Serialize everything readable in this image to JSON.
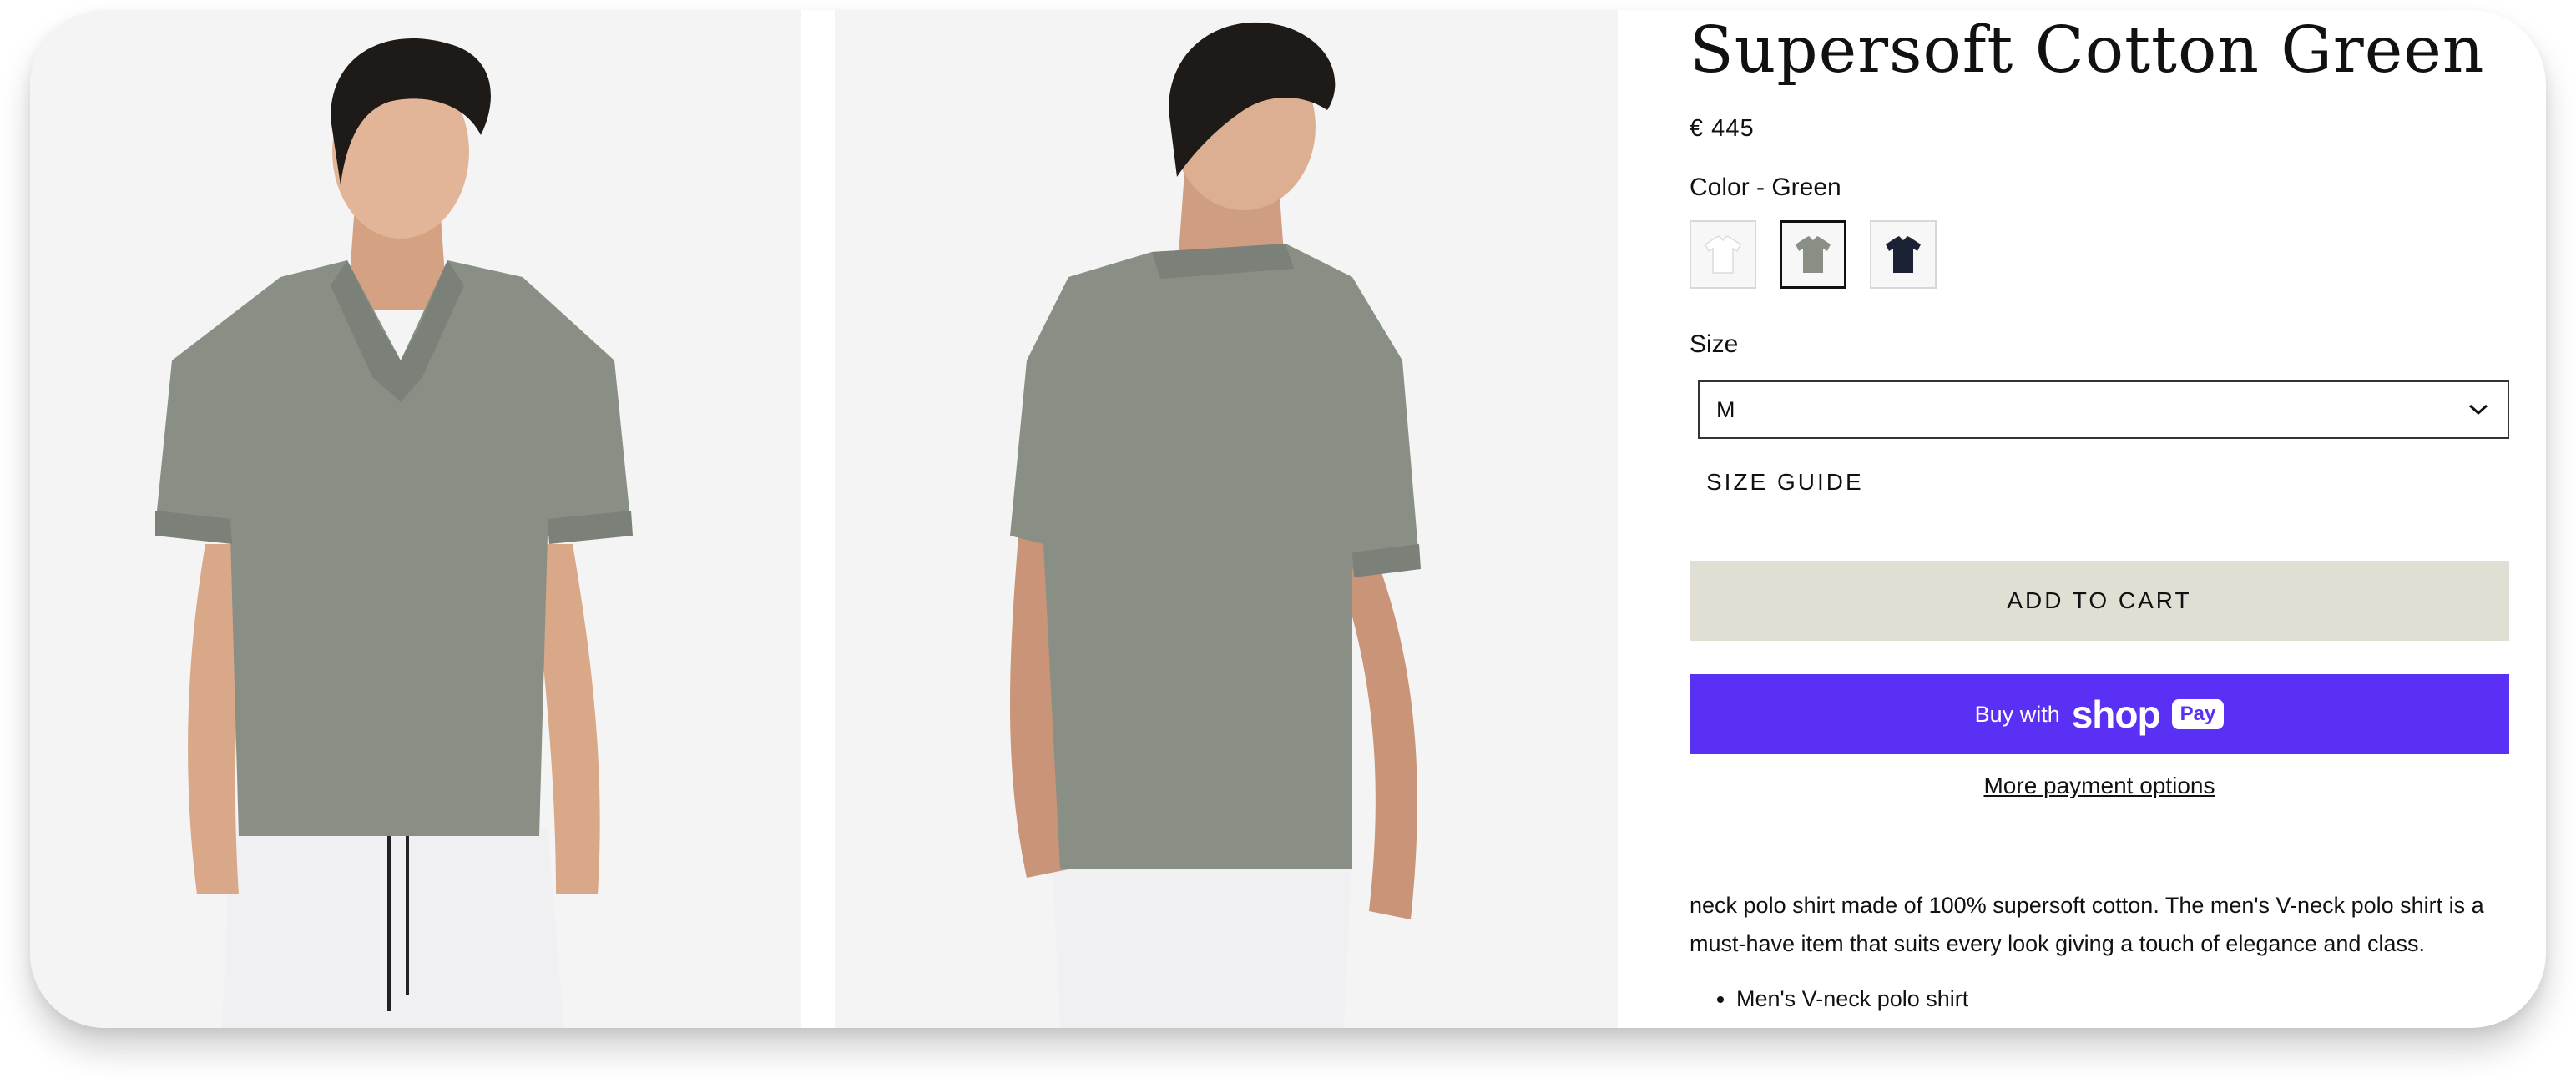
{
  "product": {
    "title": "Supersoft Cotton Green",
    "price": "€ 445",
    "color_label": "Color - Green",
    "swatches": [
      {
        "name": "White",
        "color": "#ffffff",
        "selected": false
      },
      {
        "name": "Green",
        "color": "#8a8f86",
        "selected": true
      },
      {
        "name": "Navy",
        "color": "#1b2233",
        "selected": false
      }
    ],
    "size_label": "Size",
    "size_selected": "M",
    "size_guide": "SIZE GUIDE",
    "add_to_cart": "ADD TO CART",
    "shop_pay": {
      "buy_with": "Buy with",
      "shop": "shop",
      "pay": "Pay",
      "color": "#5a31f4"
    },
    "more_payment_options": "More payment options",
    "description": "neck polo shirt made of 100% supersoft cotton. The men's V-neck polo shirt is a must-have item that suits every look giving a touch of elegance and class.",
    "bullets": [
      "Men's V-neck polo shirt"
    ]
  },
  "colors": {
    "shirt": "#8a8f86",
    "add_to_cart_bg": "#e1dfd3",
    "photo_bg": "#f4f4f4"
  }
}
